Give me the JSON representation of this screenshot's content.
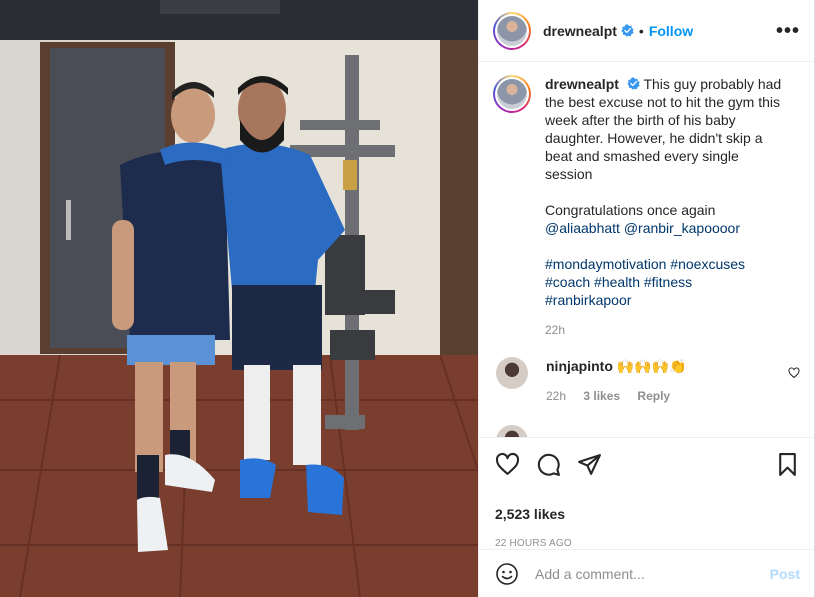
{
  "post": {
    "username": "drewnealpt",
    "follow_label": "Follow",
    "more_label": "•••",
    "dot": "•"
  },
  "caption": {
    "username": "drewnealpt",
    "text": "This guy probably had the best excuse not to hit the gym this week after the birth of his baby daughter. However, he didn't skip a beat and smashed every single session",
    "congrats": "Congratulations once again",
    "mentions": [
      "@aliaabhatt",
      "@ranbir_kapoooor"
    ],
    "hashtags": [
      "#mondaymotivation",
      "#noexcuses",
      "#coach",
      "#health",
      "#fitness",
      "#ranbirkapoor"
    ],
    "time": "22h"
  },
  "comments": [
    {
      "username": "ninjapinto",
      "text": "🙌🙌🙌👏",
      "time": "22h",
      "likes": "3 likes",
      "reply_label": "Reply"
    }
  ],
  "stats": {
    "likes": "2,523 likes",
    "timestamp": "22 HOURS AGO"
  },
  "composer": {
    "placeholder": "Add a comment...",
    "post_label": "Post"
  },
  "colors": {
    "accent": "#0095f6",
    "link": "#00376b",
    "muted": "#8e8e8e",
    "post_disabled": "#b3dbff"
  },
  "icons": [
    "verified-badge-icon",
    "more-options-icon",
    "heart-icon",
    "comment-icon",
    "share-icon",
    "bookmark-icon",
    "emoji-icon"
  ]
}
